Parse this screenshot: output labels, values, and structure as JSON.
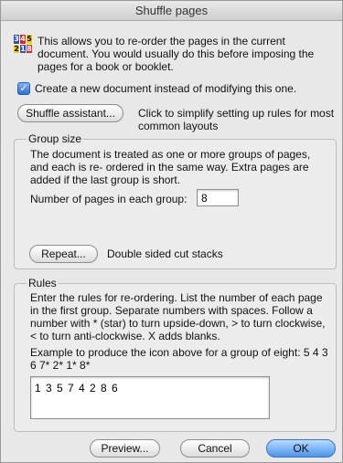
{
  "window": {
    "title": "Shuffle pages"
  },
  "header": {
    "icon_name": "page-order-icon",
    "icon_digits": [
      "3",
      "4",
      "5",
      "2",
      "1",
      "8"
    ],
    "description": "This allows you to re-order the pages in the current document. You would usually do this before imposing the pages for a book or booklet."
  },
  "options": {
    "create_new_label": "Create a new document instead of modifying this one.",
    "create_new_checked": true
  },
  "assistant": {
    "button_label": "Shuffle assistant...",
    "hint": "Click to simplify setting up rules for most common layouts"
  },
  "group_size": {
    "title": "Group size",
    "description": "The document is treated as one or more groups of pages, and each is re- ordered in the same way. Extra pages are added if the last group is short.",
    "pages_label": "Number of pages in each group:",
    "pages_value": "8",
    "repeat_button": "Repeat...",
    "repeat_hint": "Double sided cut stacks"
  },
  "rules": {
    "title": "Rules",
    "description": "Enter the rules for re-ordering. List the number of each page in the first group. Separate numbers with spaces. Follow a number with * (star)  to turn upside-down, > to turn clockwise, < to turn anti-clockwise. X adds blanks.",
    "example": "Example to produce the icon above for a group of eight: 5 4 3 6 7* 2* 1* 8*",
    "value": "1 3 5 7 4 2 8 6"
  },
  "footer": {
    "preview": "Preview...",
    "cancel": "Cancel",
    "ok": "OK"
  },
  "colors": {
    "accent": "#4a93ea",
    "icon_blue": "#2b4ec9",
    "icon_red": "#e02222",
    "icon_yellow": "#f3d000"
  }
}
